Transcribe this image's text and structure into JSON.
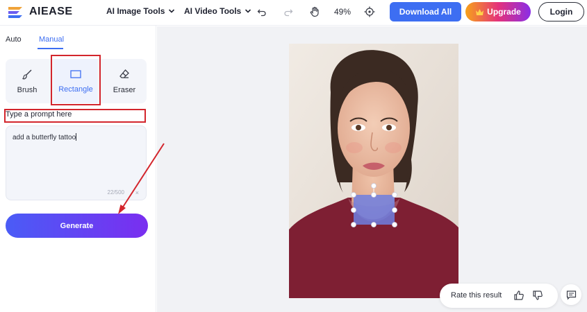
{
  "header": {
    "logo_text": "AIEASE",
    "nav": {
      "image_tools": "AI Image Tools",
      "video_tools": "AI Video Tools"
    },
    "zoom": "49%",
    "download_label": "Download All",
    "upgrade_label": "Upgrade",
    "login_label": "Login"
  },
  "sidebar": {
    "tabs": [
      {
        "label": "Auto",
        "active": false
      },
      {
        "label": "Manual",
        "active": true
      }
    ],
    "modes": [
      {
        "label": "Brush",
        "icon": "brush-icon"
      },
      {
        "label": "Rectangle",
        "icon": "rectangle-icon",
        "selected": true
      },
      {
        "label": "Eraser",
        "icon": "eraser-icon"
      }
    ],
    "prompt_label": "Type a prompt here",
    "prompt_value": "add a butterfly tattoo",
    "counter": "22/500",
    "clear": "×",
    "generate_label": "Generate"
  },
  "canvas": {
    "rate_label": "Rate this result"
  },
  "colors": {
    "accent": "#3d6ef2",
    "annotation_red": "#d3252c",
    "selection_fill": "#6f7fe0"
  }
}
